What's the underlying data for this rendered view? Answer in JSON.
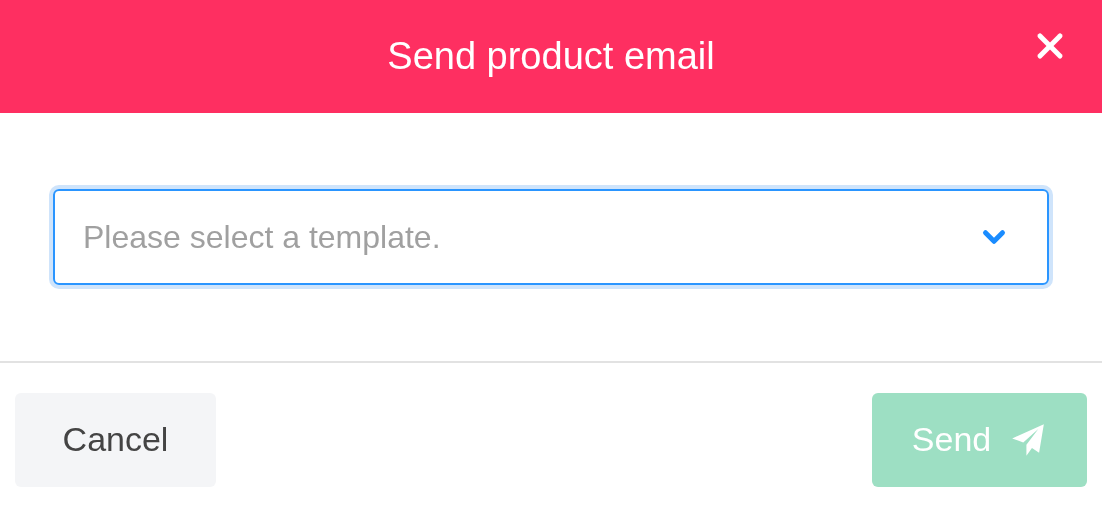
{
  "dialog": {
    "title": "Send product email"
  },
  "template_select": {
    "placeholder": "Please select a template.",
    "focused": true
  },
  "buttons": [
    {
      "label": "Cancel",
      "kind": "secondary",
      "disabled": false
    },
    {
      "label": "Send",
      "kind": "primary",
      "disabled": true
    }
  ]
}
